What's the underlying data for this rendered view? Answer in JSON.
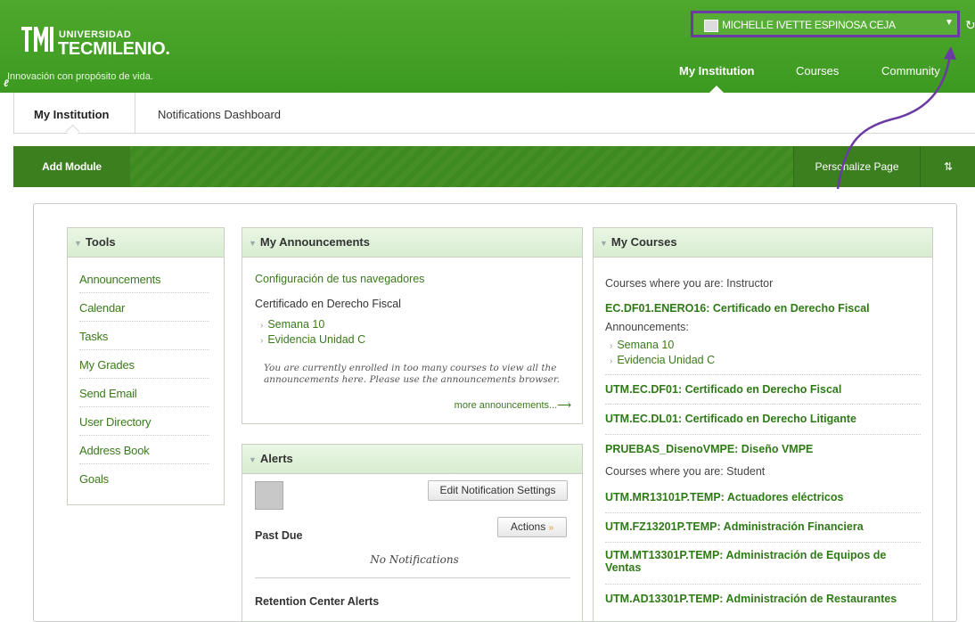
{
  "header": {
    "logo_small": "UNIVERSIDAD",
    "logo_big": "TECMILENIO.",
    "tagline": "Innovación con propósito de vida.",
    "user_name": "MICHELLE IVETTE ESPINOSA CEJA",
    "nav": [
      "My Institution",
      "Courses",
      "Community"
    ]
  },
  "subtabs": [
    "My Institution",
    "Notifications Dashboard"
  ],
  "actionbar": {
    "add_module": "Add Module",
    "personalize": "Personalize Page",
    "reorder": "⇅"
  },
  "tools": {
    "title": "Tools",
    "items": [
      "Announcements",
      "Calendar",
      "Tasks",
      "My Grades",
      "Send Email",
      "User Directory",
      "Address Book",
      "Goals"
    ]
  },
  "announcements": {
    "title": "My Announcements",
    "link1": "Configuración de tus navegadores",
    "course": "Certificado en Derecho Fiscal",
    "bullets": [
      "Semana 10",
      "Evidencia Unidad C"
    ],
    "note": "You are currently enrolled in too many courses to view all the announcements here. Please use the announcements browser.",
    "more": "more announcements...⟶"
  },
  "alerts": {
    "title": "Alerts",
    "edit_button": "Edit Notification Settings",
    "actions_button": "Actions",
    "past_due": "Past Due",
    "no_notifications": "No Notifications",
    "retention": "Retention Center Alerts"
  },
  "courses": {
    "title": "My Courses",
    "instructor_label": "Courses where you are: Instructor",
    "c1": "EC.DF01.ENERO16: Certificado en Derecho Fiscal",
    "ann_label": "Announcements:",
    "bullets": [
      "Semana 10",
      "Evidencia Unidad C"
    ],
    "c2": "UTM.EC.DF01: Certificado en Derecho Fiscal",
    "c3": "UTM.EC.DL01: Certificado en Derecho Litigante",
    "c4": "PRUEBAS_DisenoVMPE: Diseño VMPE",
    "student_label": "Courses where you are: Student",
    "c5": "UTM.MR13101P.TEMP: Actuadores eléctricos",
    "c6": "UTM.FZ13201P.TEMP: Administración Financiera",
    "c7": "UTM.MT13301P.TEMP: Administración de Equipos de Ventas",
    "c8": "UTM.AD13301P.TEMP: Administración de Restaurantes"
  },
  "colors": {
    "brand_green": "#4fa82d",
    "link_green": "#3a7a1a",
    "annotation_purple": "#6b3aa3"
  }
}
